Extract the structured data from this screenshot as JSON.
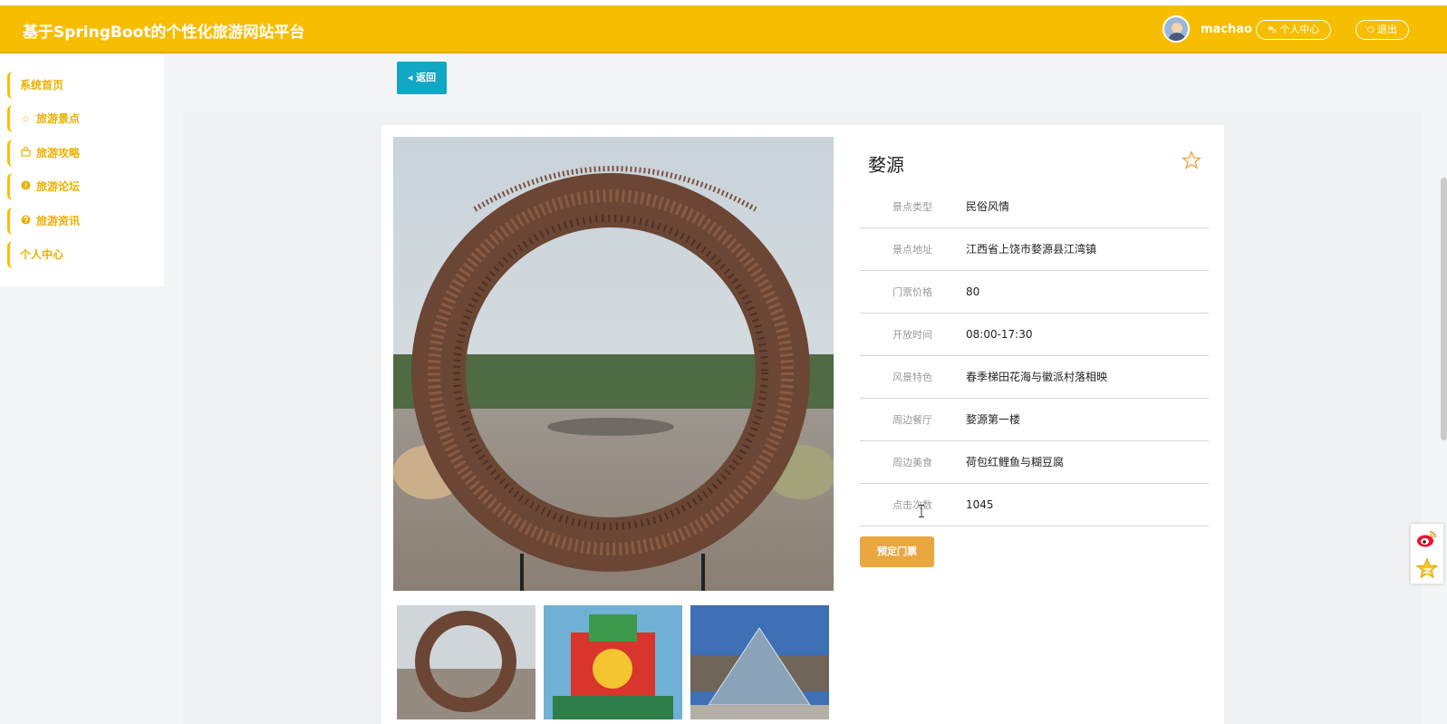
{
  "header": {
    "title": "基于SpringBoot的个性化旅游网站平台",
    "username": "machao",
    "user_center_label": "个人中心",
    "logout_label": "退出"
  },
  "sidebar": {
    "items": [
      {
        "label": "系统首页",
        "icon": "none"
      },
      {
        "label": "旅游景点",
        "icon": "star-icon"
      },
      {
        "label": "旅游攻略",
        "icon": "bag-icon"
      },
      {
        "label": "旅游论坛",
        "icon": "info-circle-icon"
      },
      {
        "label": "旅游资讯",
        "icon": "question-circle-icon"
      },
      {
        "label": "个人中心",
        "icon": "none"
      }
    ]
  },
  "back_label": "返回",
  "spot": {
    "name": "婺源",
    "fields": [
      {
        "label": "景点类型",
        "value": "民俗风情"
      },
      {
        "label": "景点地址",
        "value": "江西省上饶市婺源县江湾镇"
      },
      {
        "label": "门票价格",
        "value": "80"
      },
      {
        "label": "开放时间",
        "value": "08:00-17:30"
      },
      {
        "label": "风景特色",
        "value": "春季梯田花海与徽派村落相映"
      },
      {
        "label": "周边餐厅",
        "value": "婺源第一楼"
      },
      {
        "label": "周边美食",
        "value": "荷包红鲤鱼与糊豆腐"
      },
      {
        "label": "点击次数",
        "value": "1045"
      }
    ]
  },
  "book_label": "预定门票",
  "colors": {
    "header": "#f7be00",
    "accent_text": "#e9b100",
    "back_button": "#12a7c4",
    "book_button": "#eaa740"
  }
}
